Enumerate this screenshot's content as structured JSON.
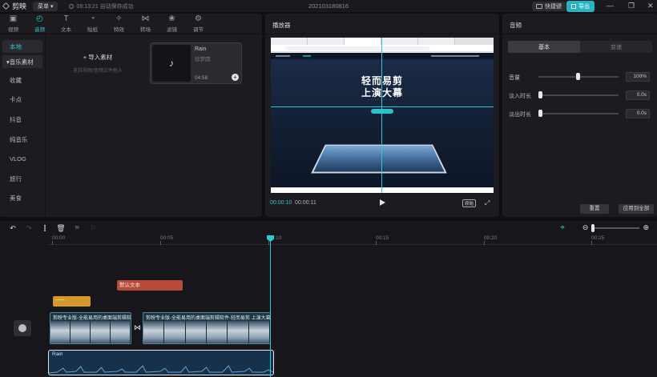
{
  "titlebar": {
    "app_name": "剪映",
    "menu_label": "菜单",
    "save_status": "09:13:21 自动保存成功",
    "project_name": "202103180816",
    "shortcut_label": "快捷键",
    "export_label": "导出"
  },
  "media_tabs": [
    {
      "label": "视频",
      "icon": "video-icon"
    },
    {
      "label": "音频",
      "icon": "audio-icon"
    },
    {
      "label": "文本",
      "icon": "text-icon"
    },
    {
      "label": "贴纸",
      "icon": "sticker-icon"
    },
    {
      "label": "特效",
      "icon": "effects-icon"
    },
    {
      "label": "转场",
      "icon": "transition-icon"
    },
    {
      "label": "滤镜",
      "icon": "filter-icon"
    },
    {
      "label": "调节",
      "icon": "adjust-icon"
    }
  ],
  "side_nav": {
    "local": "本地",
    "music_library": "音乐素材",
    "items": [
      "收藏",
      "卡点",
      "抖音",
      "纯音乐",
      "VLOG",
      "旅行",
      "美食"
    ]
  },
  "import": {
    "title": "+ 导入素材",
    "hint": "支持视频/音频文件拖入"
  },
  "music_card": {
    "title": "Rain",
    "artist": "徐梦圆",
    "duration": "04:58"
  },
  "player": {
    "title": "播放器",
    "time_current": "00:00:10",
    "time_total": "00:00:11",
    "ratio_label": "原始",
    "hero_line1": "轻而易剪",
    "hero_line2": "上演大幕"
  },
  "properties": {
    "title": "音频",
    "tabs": [
      "基本",
      "变速"
    ],
    "volume_label": "音量",
    "volume_value": "100%",
    "volume_level": 0.5,
    "fade_in_label": "淡入时长",
    "fade_in_value": "0.0s",
    "fade_out_label": "淡出时长",
    "fade_out_value": "0.0s",
    "reset_label": "重置",
    "apply_all_label": "应用到全部"
  },
  "timeline": {
    "ruler": [
      "00:00",
      "00:05",
      "00:10",
      "00:15",
      "00:20",
      "00:25"
    ],
    "text_clip": "默认文本",
    "sticker_clip": "一一",
    "video_clip_1": "剪映专业版-全能易用的桌面端剪辑软件",
    "video_clip_2": "剪映专业版-全能易用的桌面端剪辑软件-轻而易剪 上演大幕",
    "audio_clip": "Rain"
  },
  "colors": {
    "accent": "#34c6d3",
    "text_clip": "#b84a3a",
    "sticker_clip": "#d39a2b",
    "audio_clip": "#17314a"
  }
}
